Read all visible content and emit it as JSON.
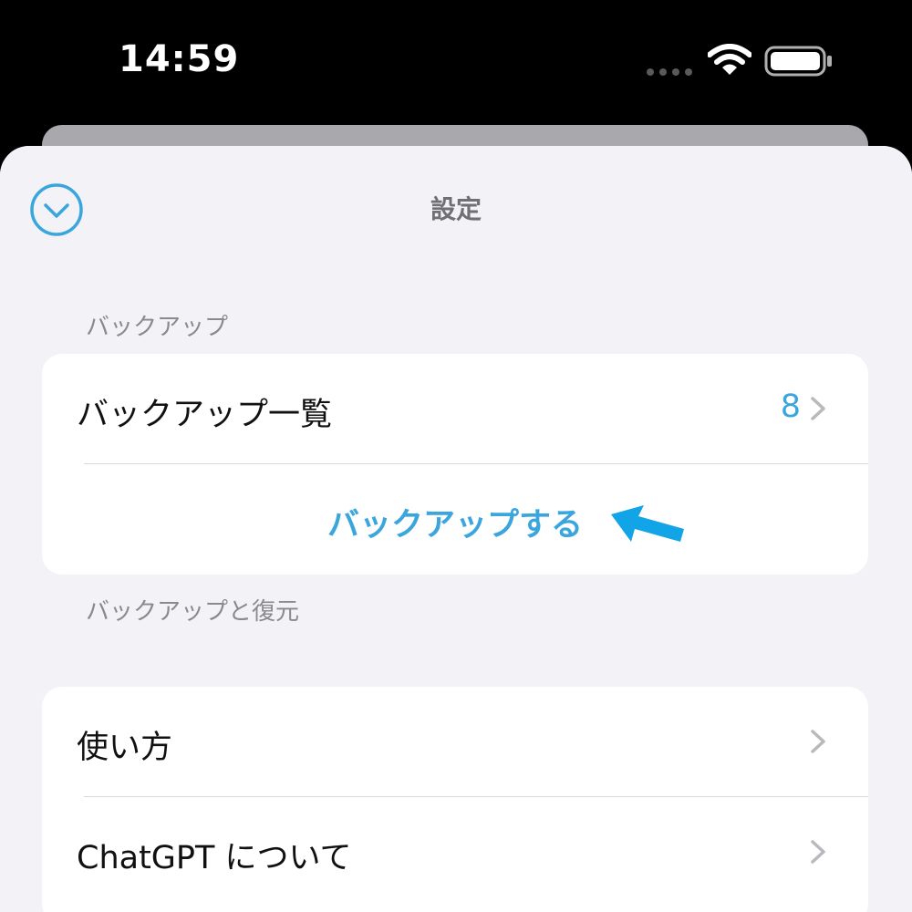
{
  "status_bar": {
    "time": "14:59"
  },
  "nav": {
    "title": "設定",
    "close_icon": "chevron-down-circle-icon"
  },
  "sections": {
    "backup": {
      "header": "バックアップ",
      "rows": {
        "list_label": "バックアップ一覧",
        "list_count": "8",
        "action_label": "バックアップする"
      },
      "footer": "バックアップと復元"
    },
    "general": {
      "rows": [
        {
          "label": "使い方"
        },
        {
          "label": "ChatGPT について"
        }
      ]
    }
  },
  "colors": {
    "accent": "#3aa6dd",
    "arrow": "#11a4e6",
    "sheet_background": "#f2f2f7"
  }
}
